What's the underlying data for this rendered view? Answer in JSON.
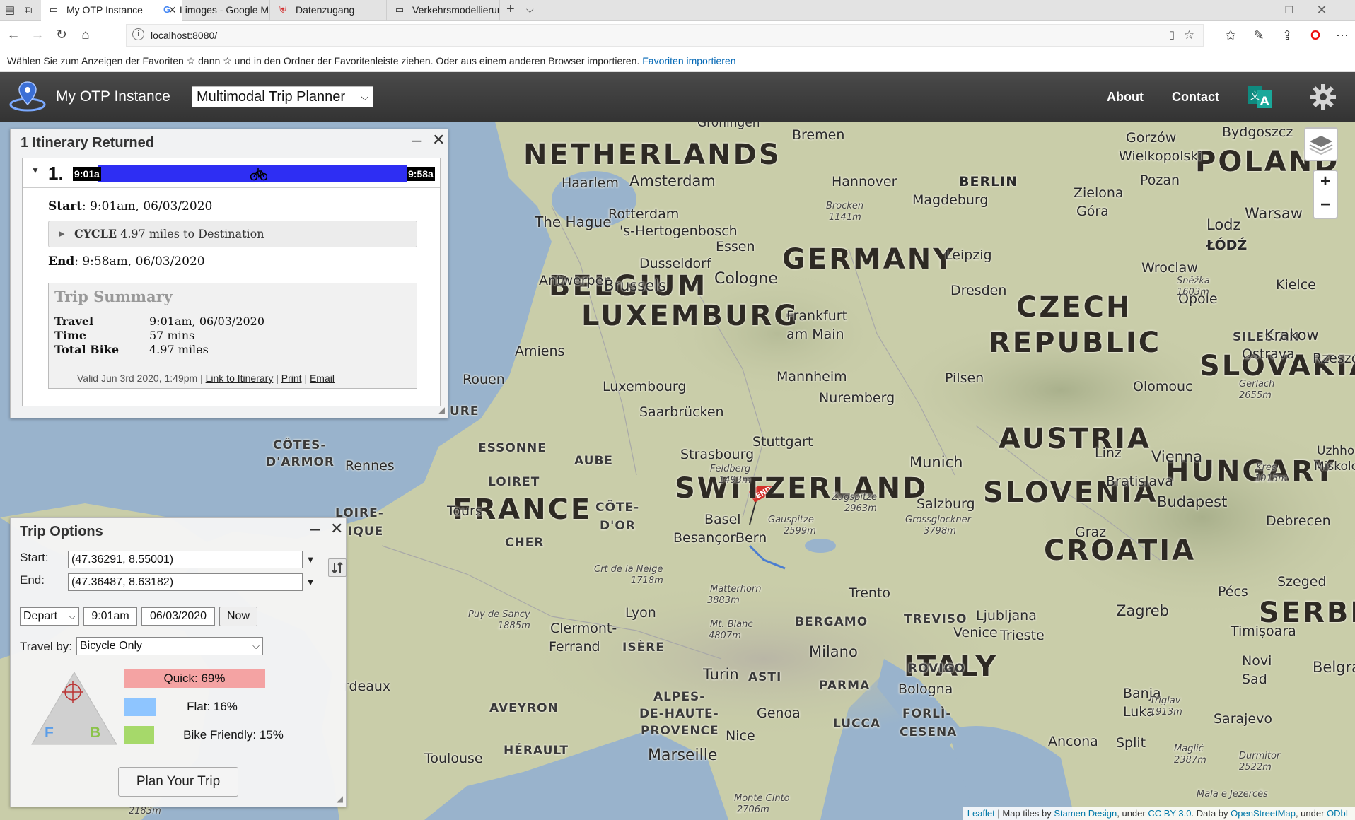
{
  "browser": {
    "tabs": [
      {
        "title": "My OTP Instance",
        "icon": "page-icon",
        "active": true
      },
      {
        "title": "Limoges - Google Maps",
        "icon": "google-icon"
      },
      {
        "title": "Datenzugang",
        "icon": "shield-icon"
      },
      {
        "title": "Verkehrsmodellierung im U",
        "icon": "page-icon"
      }
    ],
    "url": "localhost:8080/",
    "favorites_hint": "Wählen Sie zum Anzeigen der Favoriten ☆ dann ☆ und in den Ordner der Favoritenleiste ziehen. Oder aus einem anderen Browser importieren.",
    "favorites_link": "Favoriten importieren"
  },
  "app": {
    "brand": "My OTP Instance",
    "mode_select": "Multimodal Trip Planner",
    "nav": [
      "About",
      "Contact"
    ],
    "header_color": "#3d3d3d"
  },
  "itinerary_panel": {
    "title": "1 Itinerary Returned",
    "number": "1.",
    "start_time_chip": "9:01a",
    "end_time_chip": "9:58a",
    "bar_color": "#2e2ef3",
    "start_label": "Start",
    "start_value": ": 9:01am, 06/03/2020",
    "leg_mode": "CYCLE",
    "leg_text": " 4.97 miles to Destination",
    "end_label": "End",
    "end_value": ": 9:58am, 06/03/2020",
    "summary": {
      "title": "Trip Summary",
      "rows": [
        {
          "label": "Travel",
          "value": "9:01am, 06/03/2020"
        },
        {
          "label": "Time",
          "value": "57 mins"
        },
        {
          "label": "Total Bike",
          "value": "4.97 miles"
        }
      ],
      "valid": "Valid Jun 3rd 2020, 1:49pm |",
      "link_itinerary": "Link to Itinerary",
      "link_print": "Print",
      "link_email": "Email",
      "pipe": "|"
    }
  },
  "trip_options": {
    "title": "Trip Options",
    "start_label": "Start:",
    "start_value": "(47.36291, 8.55001)",
    "end_label": "End:",
    "end_value": "(47.36487, 8.63182)",
    "depart": "Depart",
    "time": "9:01am",
    "date": "06/03/2020",
    "now_button": "Now",
    "travel_by_label": "Travel by:",
    "travel_by_value": "Bicycle Only",
    "triangle_f": "F",
    "triangle_b": "B",
    "quick_label": "Quick: 69%",
    "flat_label": "Flat: 16%",
    "bike_friendly_label": "Bike Friendly: 15%",
    "quick_pct": 69,
    "flat_pct": 16,
    "bike_friendly_pct": 15,
    "quick_color": "#f4a3a3",
    "flat_color": "#8ec5ff",
    "bike_color": "#a6d96a",
    "plan_button": "Plan Your Trip"
  },
  "map": {
    "end_marker": "END",
    "zoom_in": "+",
    "zoom_out": "−",
    "countries": [
      "NETHERLANDS",
      "POLAND",
      "GERMANY",
      "BELGIUM",
      "LUXEMBURG",
      "CZECH",
      "REPUBLIC",
      "SLOVAKIA",
      "AUSTRIA",
      "HUNGARY",
      "SWITZERLAND",
      "SLOVENIA",
      "CROATIA",
      "FRANCE",
      "ITALY",
      "SERBI"
    ],
    "regions": [
      "SILESIAN",
      "CÔTES-",
      "D'ARMOR",
      "ESSONNE",
      "AUBE",
      "LOIRET",
      "CÔTE-",
      "D'OR",
      "CHER",
      "LOIRE-",
      "IQUE",
      "URE",
      "BERGAMO",
      "TREVISO",
      "ROVIGO",
      "PARMA",
      "FORLÌ-",
      "CESENA",
      "LUCCA",
      "ISÈRE",
      "ASTI",
      "ALPES-",
      "DE-HAUTE-",
      "PROVENCE",
      "AVEYRON",
      "HÉRAULT"
    ],
    "cities": [
      "Groningen",
      "Bremen",
      "Gorzów",
      "Wielkopolski",
      "Bydgoszcz",
      "Haarlem",
      "Amsterdam",
      "Hannover",
      "BERLIN",
      "Zielona",
      "Góra",
      "Pozan",
      "Warsaw",
      "The Hague",
      "Rotterdam",
      "'s-Hertogenbosch",
      "Magdeburg",
      "Lodz",
      "ŁÓDŹ",
      "Essen",
      "Dusseldorf",
      "Leipzig",
      "Wroclaw",
      "Kielce",
      "Antwerpen",
      "Brussels",
      "Cologne",
      "Dresden",
      "Opole",
      "Frankfurt",
      "am Main",
      "Amiens",
      "Krakow",
      "Ostrava",
      "Rzeszów",
      "Rouen",
      "Mannheim",
      "Pilsen",
      "Olomouc",
      "Luxembourg",
      "Nuremberg",
      "Saarbrücken",
      "Strasbourg",
      "Stuttgart",
      "Rennes",
      "Munich",
      "Linz",
      "Vienna",
      "Uzhhor",
      "Miskolc",
      "Bratislava",
      "Tours",
      "Salzburg",
      "Budapest",
      "Basel",
      "Debrecen",
      "Besançon",
      "Bern",
      "Graz",
      "Szeged",
      "Trento",
      "Pécs",
      "Lyon",
      "Zagreb",
      "Clermont-",
      "Ferrand",
      "Ljubljana",
      "Venice",
      "Trieste",
      "Timișoara",
      "Milano",
      "Turin",
      "Novi",
      "Sad",
      "Belgrade",
      "Bologna",
      "Genoa",
      "Banja",
      "Luka",
      "Sarajevo",
      "Nice",
      "Marseille",
      "Toulouse",
      "Ancona",
      "Split",
      "rdeaux"
    ],
    "peaks": [
      "Brocken",
      "1141m",
      "Sněžka",
      "1603m",
      "Feldberg",
      "1493m",
      "Zugspitze",
      "2963m",
      "Grossglockner",
      "3798m",
      "Gauspitze",
      "2599m",
      "Crt de la Neige",
      "1718m",
      "Matterhorn",
      "3883m",
      "Mt. Blanc",
      "4807m",
      "Puy de Sancy",
      "1885m",
      "Gerlach",
      "2655m",
      "Kres",
      "1015m",
      "Triglav",
      "1913m",
      "Maglić",
      "2387m",
      "Durmitor",
      "2522m",
      "Monte Cinto",
      "2706m",
      "2183m",
      "Mala e Jezercës"
    ],
    "attribution": {
      "leaflet": "Leaflet",
      "tiles": " | Map tiles by ",
      "stamen": "Stamen Design",
      "under1": ", under ",
      "ccby": "CC BY 3.0",
      "data": ". Data by ",
      "osm": "OpenStreetMap",
      "under2": ", under ",
      "odbl": "ODbL"
    }
  }
}
